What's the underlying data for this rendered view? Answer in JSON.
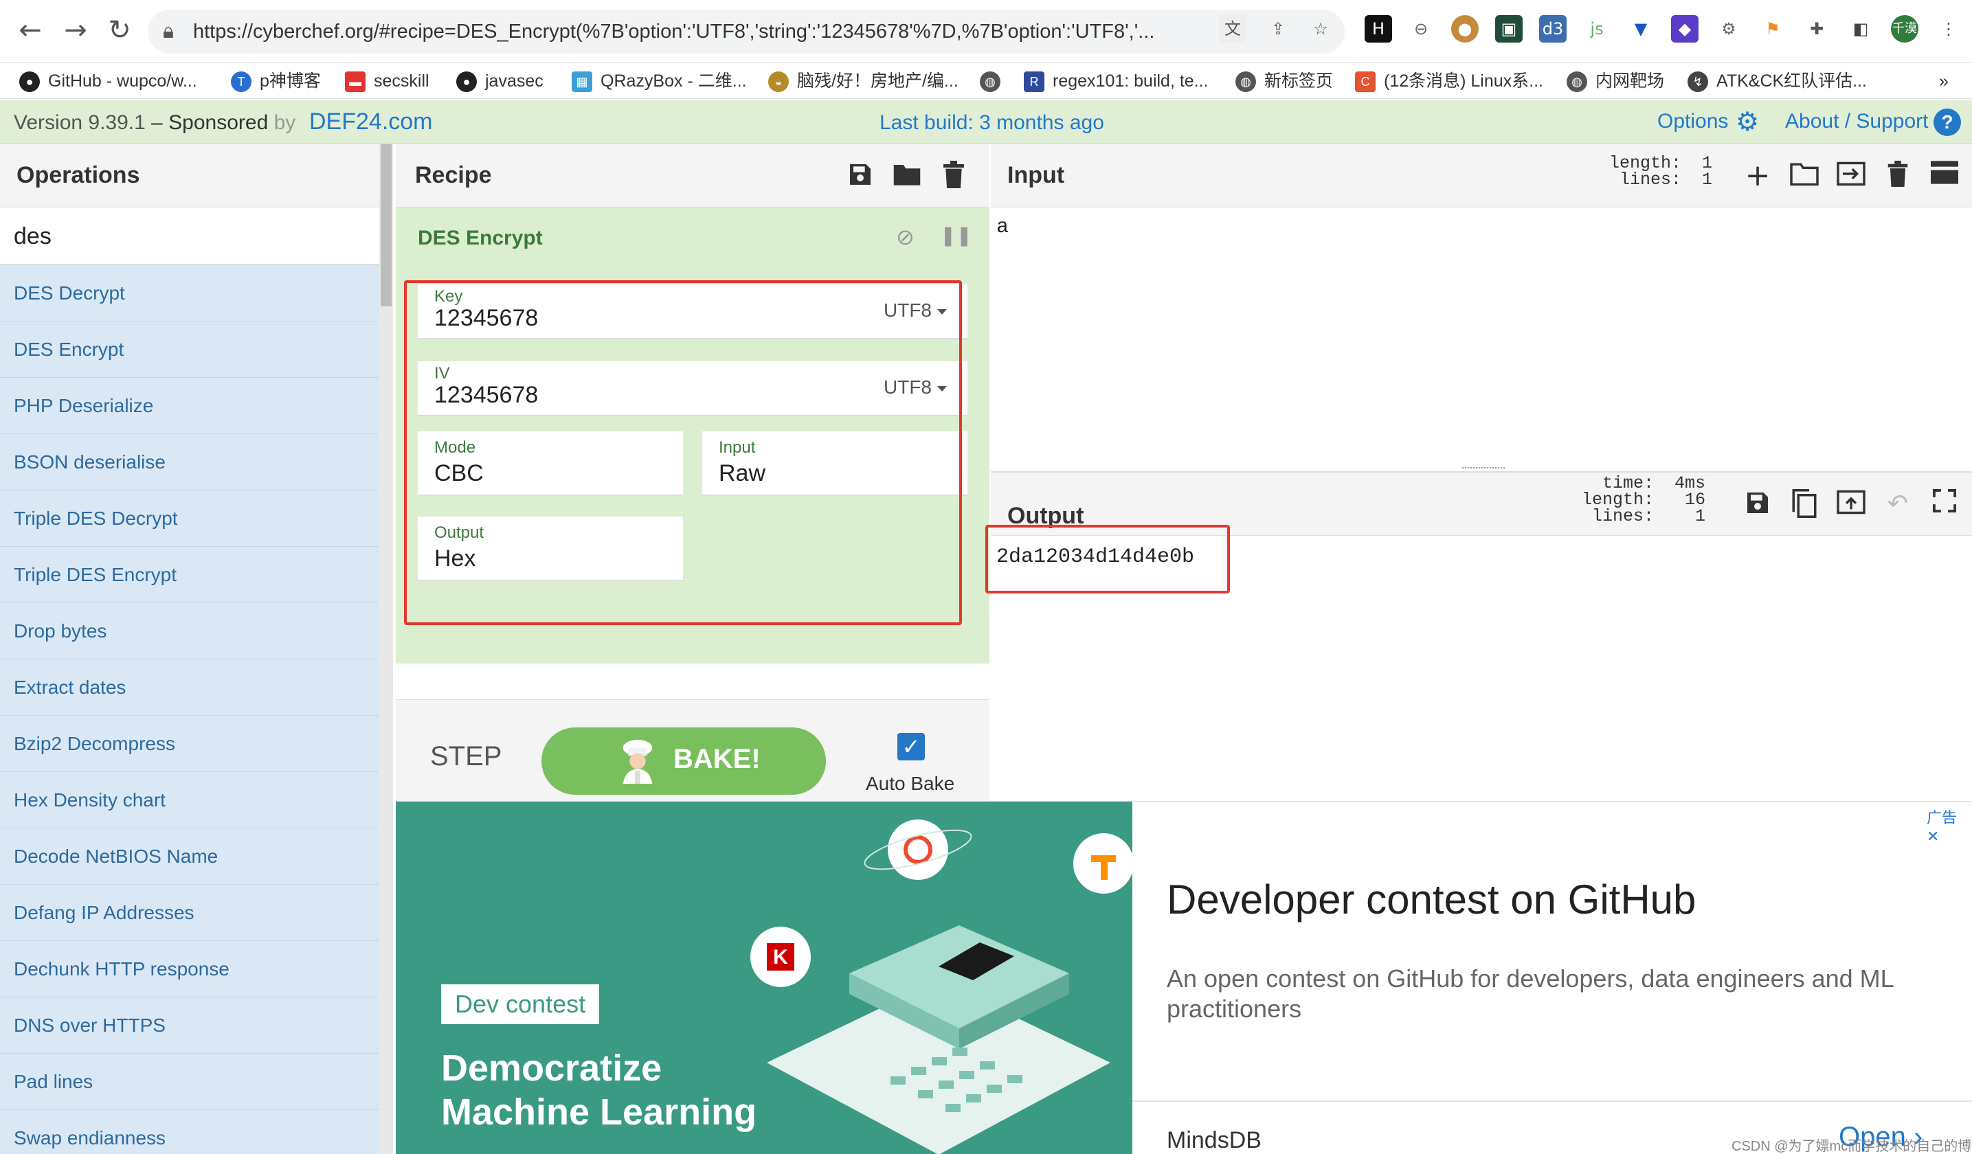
{
  "browser": {
    "url": "https://cyberchef.org/#recipe=DES_Encrypt(%7B'option':'UTF8','string':'12345678'%7D,%7B'option':'UTF8','...",
    "bookmarks": [
      {
        "label": "GitHub - wupco/w...",
        "icon": "github-icon",
        "color": "#222"
      },
      {
        "label": "p神博客",
        "icon": "blog-icon",
        "color": "#2b6ecf"
      },
      {
        "label": "secskill",
        "icon": "secskill-icon",
        "color": "#e3342f"
      },
      {
        "label": "javasec",
        "icon": "github-icon",
        "color": "#222"
      },
      {
        "label": "QRazyBox - 二维...",
        "icon": "qr-icon",
        "color": "#3aa0d8"
      },
      {
        "label": "脑残/好！房地产/编...",
        "icon": "mushroom-icon",
        "color": "#b58b2a"
      },
      {
        "label": "",
        "icon": "globe-icon",
        "color": "#555"
      },
      {
        "label": "regex101: build, te...",
        "icon": "regex-icon",
        "color": "#2d4b9a"
      },
      {
        "label": "新标签页",
        "icon": "globe-icon",
        "color": "#555"
      },
      {
        "label": "(12条消息) Linux系...",
        "icon": "csdn-icon",
        "color": "#e3542f"
      },
      {
        "label": "内网靶场",
        "icon": "globe-icon",
        "color": "#555"
      },
      {
        "label": "ATK&CK红队评估...",
        "icon": "atk-icon",
        "color": "#444"
      }
    ],
    "more": "»",
    "avatar_text": "千漠"
  },
  "banner": {
    "version": "Version 9.39.1",
    "dash": " – ",
    "sponsored": "Sponsored",
    "by": " by",
    "sponsor": "DEF24.com",
    "last_build": "Last build: 3 months ago",
    "options": "Options",
    "about": "About / Support"
  },
  "operations": {
    "title": "Operations",
    "search_value": "des",
    "items": [
      "DES Decrypt",
      "DES Encrypt",
      "PHP Deserialize",
      "BSON deserialise",
      "Triple DES Decrypt",
      "Triple DES Encrypt",
      "Drop bytes",
      "Extract dates",
      "Bzip2 Decompress",
      "Hex Density chart",
      "Decode NetBIOS Name",
      "Defang IP Addresses",
      "Dechunk HTTP response",
      "DNS over HTTPS",
      "Pad lines",
      "Swap endianness"
    ]
  },
  "recipe": {
    "title": "Recipe",
    "operation": "DES Encrypt",
    "key_label": "Key",
    "key_value": "12345678",
    "key_encoding": "UTF8",
    "iv_label": "IV",
    "iv_value": "12345678",
    "iv_encoding": "UTF8",
    "mode_label": "Mode",
    "mode_value": "CBC",
    "input_label": "Input",
    "input_value": "Raw",
    "output_label": "Output",
    "output_value": "Hex",
    "step_label": "STEP",
    "bake_label": "BAKE!",
    "auto_bake_label": "Auto Bake",
    "auto_bake_checked": true
  },
  "input": {
    "title": "Input",
    "stats": "length:  1\n lines:  1",
    "text": "a"
  },
  "output": {
    "title": "Output",
    "stats": "  time:  4ms\nlength:   16\n lines:    1",
    "text": "2da12034d14d4e0b"
  },
  "ad": {
    "tag": "Dev contest",
    "headline": "Democratize\nMachine Learning",
    "title": "Developer contest on GitHub",
    "description": "An open contest on GitHub for developers, data engineers and ML practitioners",
    "brand": "MindsDB",
    "cta": "Open",
    "marker": "广告 ✕",
    "watermark": "CSDN @为了嫖mc而学技术的自己的博客"
  },
  "colors": {
    "accent": "#2378c8",
    "recipe_green": "#dceed0",
    "bake_green": "#7abf5e",
    "highlight_red": "#e2382d"
  }
}
